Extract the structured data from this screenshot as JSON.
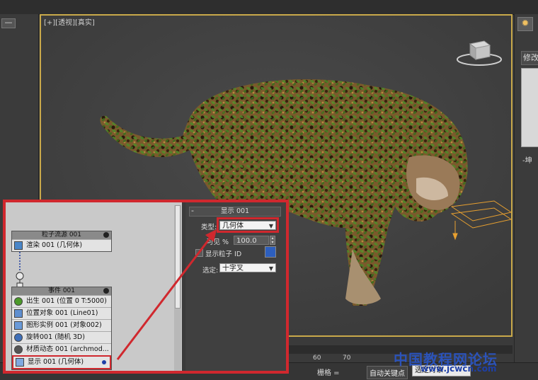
{
  "viewport": {
    "label": "[+][透视][真实]"
  },
  "right_panel": {
    "modify_label": "修改",
    "glyph": "-坤"
  },
  "left_panel": {
    "minus_label": "—"
  },
  "timeline": {
    "tick_60": "60",
    "tick_70": "70"
  },
  "status_bar": {
    "grid_label": "栅格 =",
    "auto_key_label": "自动关键点",
    "selected_object_value": "选定对象"
  },
  "watermark": {
    "text": "中国教程网论坛",
    "url": "www.jcwcn.com"
  },
  "particle_view": {
    "particle_source_node": {
      "title": "粒子流源 001",
      "rows": [
        "渲染 001 (几何体)"
      ]
    },
    "event_node": {
      "title": "事件 001",
      "rows": [
        "出生 001 (位置 0 T:5000)",
        "位置对象 001 (Line01)",
        "图形实例 001 (对象002)",
        "旋转001 (随机 3D)",
        "材质动态 001 (archmod...",
        "显示 001 (几何体)"
      ]
    }
  },
  "display_rollout": {
    "title": "显示 001",
    "type_label": "类型:",
    "type_value": "几何体",
    "visible_label": "可见 %",
    "visible_value": "100.0",
    "show_particle_id_label": "显示粒子 ID",
    "selected_label": "选定:",
    "selected_value": "十字叉"
  },
  "colors": {
    "callout_red": "#d0282e",
    "viewport_border": "#c9a94a",
    "display_swatch": "#2d5fbe"
  }
}
